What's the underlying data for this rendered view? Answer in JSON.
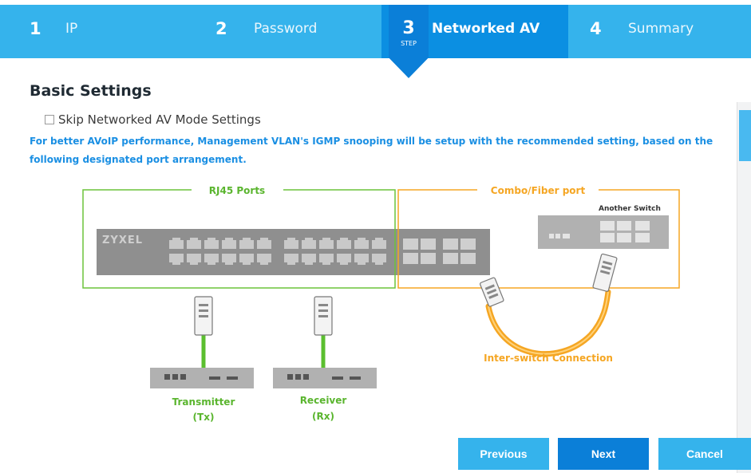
{
  "steps": [
    {
      "number": "1",
      "label": "IP"
    },
    {
      "number": "2",
      "label": "Password"
    },
    {
      "number": "3",
      "label": "Networked AV",
      "badge": "STEP"
    },
    {
      "number": "4",
      "label": "Summary"
    }
  ],
  "section_title": "Basic Settings",
  "skip_checkbox": {
    "label": "Skip Networked AV Mode Settings",
    "checked": false
  },
  "info_text": "For better AVoIP performance, Management VLAN's IGMP snooping will be setup with the recommended setting, based on the following designated port arrangement.",
  "diagram": {
    "rj45_label": "RJ45 Ports",
    "combo_label": "Combo/Fiber port",
    "brand": "ZYXEL",
    "another_switch": "Another Switch",
    "inter_switch": "Inter-switch Connection",
    "tx_label_1": "Transmitter",
    "tx_label_2": "(Tx)",
    "rx_label_1": "Receiver",
    "rx_label_2": "(Rx)",
    "colors": {
      "rj45": "#6cc43a",
      "combo": "#f5a623",
      "label_green": "#5ab52e",
      "cable_green": "#5bbf2f",
      "cable_orange": "#f5a623"
    }
  },
  "buttons": {
    "previous": "Previous",
    "next": "Next",
    "cancel": "Cancel"
  }
}
